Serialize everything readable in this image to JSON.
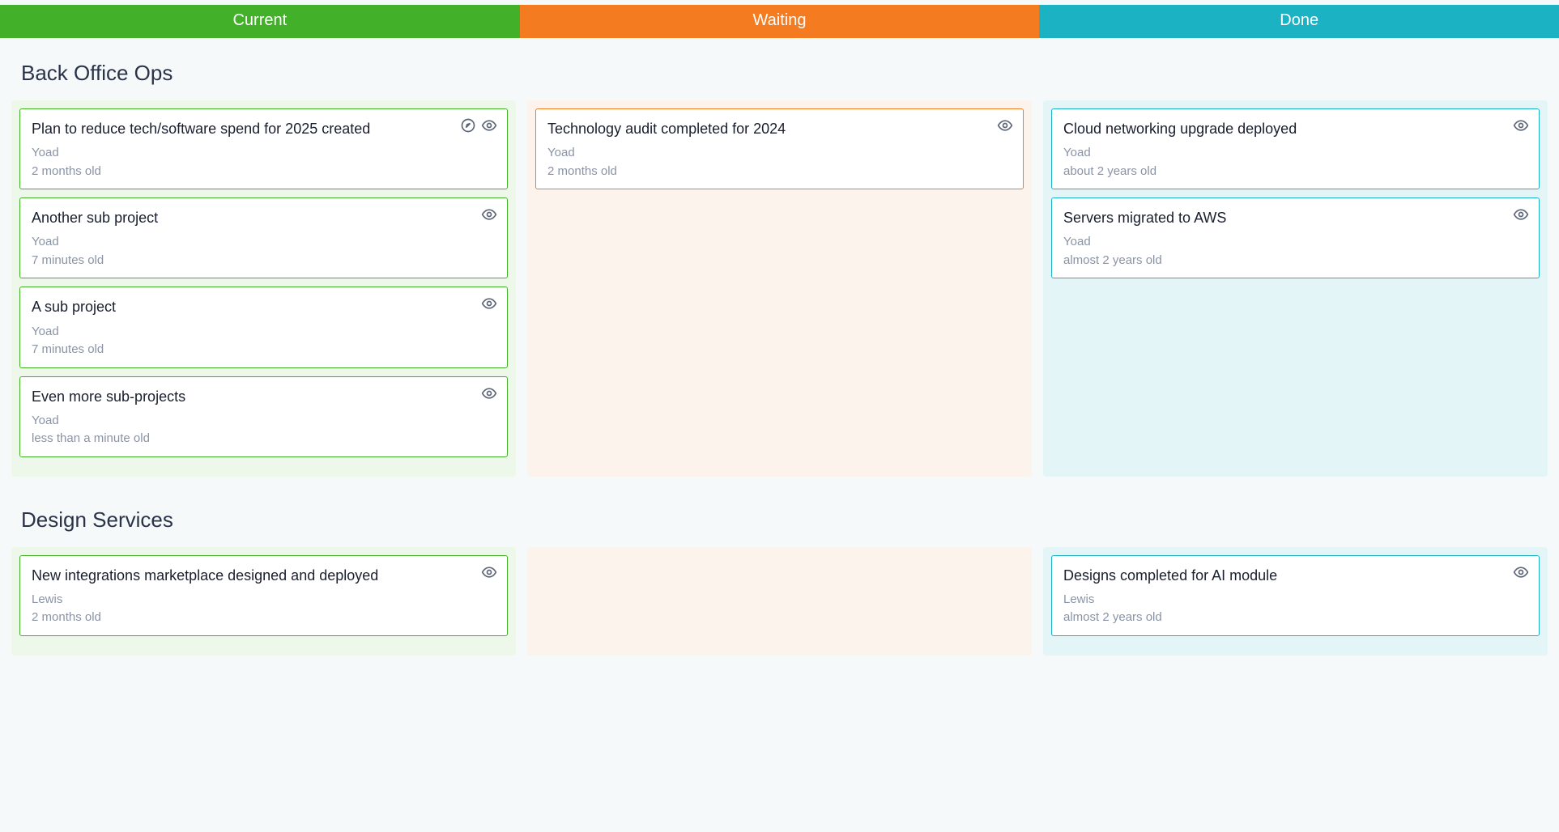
{
  "columns": {
    "current": "Current",
    "waiting": "Waiting",
    "done": "Done"
  },
  "colors": {
    "current": "#43b02a",
    "waiting": "#f47b20",
    "done": "#1bb2c4"
  },
  "groups": [
    {
      "name": "Back Office Ops",
      "current": [
        {
          "title": "Plan to reduce tech/software spend for 2025 created",
          "owner": "Yoad",
          "age": "2 months old",
          "has_compass": true
        },
        {
          "title": "Another sub project",
          "owner": "Yoad",
          "age": "7 minutes old",
          "has_compass": false
        },
        {
          "title": "A sub project",
          "owner": "Yoad",
          "age": "7 minutes old",
          "has_compass": false
        },
        {
          "title": "Even more sub-projects",
          "owner": "Yoad",
          "age": "less than a minute old",
          "has_compass": false
        }
      ],
      "waiting": [
        {
          "title": "Technology audit completed for 2024",
          "owner": "Yoad",
          "age": "2 months old",
          "has_compass": false
        }
      ],
      "done": [
        {
          "title": "Cloud networking upgrade deployed",
          "owner": "Yoad",
          "age": "about 2 years old",
          "has_compass": false
        },
        {
          "title": "Servers migrated to AWS",
          "owner": "Yoad",
          "age": "almost 2 years old",
          "has_compass": false
        }
      ]
    },
    {
      "name": "Design Services",
      "current": [
        {
          "title": "New integrations marketplace designed and deployed",
          "owner": "Lewis",
          "age": "2 months old",
          "has_compass": false
        }
      ],
      "waiting": [],
      "done": [
        {
          "title": "Designs completed for AI module",
          "owner": "Lewis",
          "age": "almost 2 years old",
          "has_compass": false
        }
      ]
    }
  ]
}
